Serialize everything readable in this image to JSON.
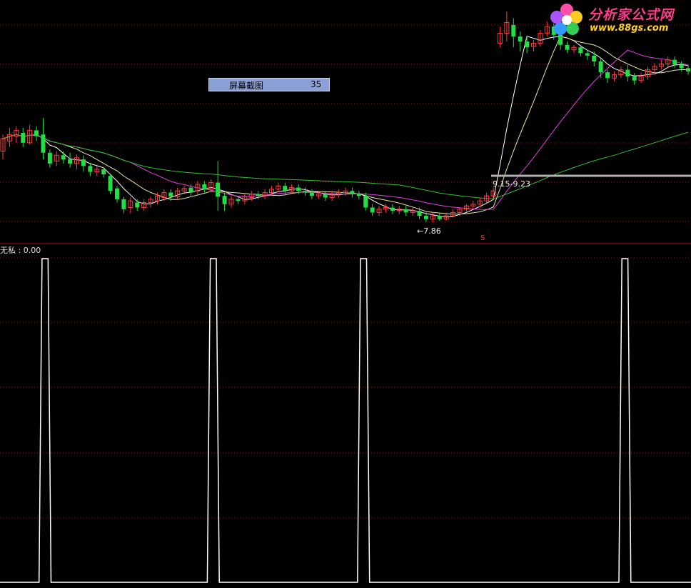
{
  "logo": {
    "title": "分析家公式网",
    "url": "www.88gs.com"
  },
  "screenshot_popup": {
    "label": "屏幕截图",
    "value": "35"
  },
  "indicator": {
    "label": "无私 : 0.00"
  },
  "annotations": {
    "low_marker": "←7.86",
    "range_label": "9.15-9.23",
    "signal_mark": "S"
  },
  "colors": {
    "up_candle": "#ff3b3b",
    "down_candle": "#22dd44",
    "ma_white": "#ffffff",
    "ma_yellow": "#e8e8a0",
    "ma_magenta": "#e040e0",
    "ma_green": "#30c030",
    "divider": "#c01010",
    "grid_dots": "#8a1a1a",
    "indicator_line": "#ffffff"
  },
  "chart_data": [
    {
      "type": "candlestick",
      "series": [
        {
          "name": "candles",
          "values": [
            [
              8.3,
              8.45,
              8.2,
              8.5
            ],
            [
              8.42,
              8.5,
              8.35,
              8.58
            ],
            [
              8.48,
              8.55,
              8.4,
              8.6
            ],
            [
              8.52,
              8.4,
              8.35,
              8.58
            ],
            [
              8.4,
              8.55,
              8.38,
              8.62
            ],
            [
              8.55,
              8.48,
              8.42,
              8.6
            ],
            [
              8.5,
              8.28,
              8.2,
              8.7
            ],
            [
              8.28,
              8.15,
              8.1,
              8.32
            ],
            [
              8.18,
              8.25,
              8.12,
              8.3
            ],
            [
              8.25,
              8.2,
              8.15,
              8.3
            ],
            [
              8.2,
              8.15,
              8.1,
              8.28
            ],
            [
              8.15,
              8.22,
              8.08,
              8.26
            ],
            [
              8.2,
              8.12,
              8.05,
              8.25
            ],
            [
              8.12,
              8.05,
              8.0,
              8.16
            ],
            [
              8.05,
              8.08,
              8.0,
              8.12
            ],
            [
              8.08,
              8.02,
              7.98,
              8.1
            ],
            [
              8.0,
              7.82,
              7.78,
              8.02
            ],
            [
              7.85,
              7.72,
              7.68,
              7.88
            ],
            [
              7.72,
              7.6,
              7.55,
              7.75
            ],
            [
              7.62,
              7.7,
              7.55,
              7.74
            ],
            [
              7.68,
              7.62,
              7.58,
              7.72
            ],
            [
              7.62,
              7.68,
              7.58,
              7.72
            ],
            [
              7.68,
              7.72,
              7.62,
              7.75
            ],
            [
              7.7,
              7.76,
              7.66,
              7.8
            ],
            [
              7.74,
              7.8,
              7.7,
              7.84
            ],
            [
              7.8,
              7.75,
              7.7,
              7.84
            ],
            [
              7.75,
              7.82,
              7.72,
              7.86
            ],
            [
              7.82,
              7.85,
              7.78,
              7.88
            ],
            [
              7.86,
              7.8,
              7.76,
              7.9
            ],
            [
              7.82,
              7.9,
              7.78,
              7.94
            ],
            [
              7.9,
              7.84,
              7.8,
              7.94
            ],
            [
              7.84,
              7.92,
              7.8,
              7.96
            ],
            [
              7.92,
              7.75,
              7.58,
              8.18
            ],
            [
              7.76,
              7.66,
              7.58,
              7.8
            ],
            [
              7.66,
              7.72,
              7.62,
              7.76
            ],
            [
              7.72,
              7.7,
              7.66,
              7.76
            ],
            [
              7.7,
              7.75,
              7.66,
              7.78
            ],
            [
              7.74,
              7.78,
              7.7,
              7.82
            ],
            [
              7.78,
              7.76,
              7.72,
              7.82
            ],
            [
              7.76,
              7.8,
              7.72,
              7.84
            ],
            [
              7.8,
              7.84,
              7.76,
              7.88
            ],
            [
              7.84,
              7.88,
              7.8,
              7.92
            ],
            [
              7.88,
              7.82,
              7.78,
              7.92
            ],
            [
              7.82,
              7.86,
              7.78,
              7.9
            ],
            [
              7.86,
              7.82,
              7.78,
              7.9
            ],
            [
              7.82,
              7.8,
              7.76,
              7.86
            ],
            [
              7.8,
              7.76,
              7.72,
              7.84
            ],
            [
              7.76,
              7.78,
              7.72,
              7.82
            ],
            [
              7.78,
              7.74,
              7.7,
              7.82
            ],
            [
              7.74,
              7.78,
              7.7,
              7.82
            ],
            [
              7.78,
              7.8,
              7.74,
              7.84
            ],
            [
              7.8,
              7.82,
              7.76,
              7.86
            ],
            [
              7.82,
              7.78,
              7.74,
              7.86
            ],
            [
              7.78,
              7.76,
              7.72,
              7.82
            ],
            [
              7.76,
              7.62,
              7.58,
              7.8
            ],
            [
              7.62,
              7.56,
              7.52,
              7.66
            ],
            [
              7.56,
              7.6,
              7.52,
              7.64
            ],
            [
              7.6,
              7.62,
              7.56,
              7.66
            ],
            [
              7.62,
              7.58,
              7.54,
              7.66
            ],
            [
              7.58,
              7.6,
              7.54,
              7.64
            ],
            [
              7.6,
              7.56,
              7.52,
              7.64
            ],
            [
              7.56,
              7.58,
              7.52,
              7.62
            ],
            [
              7.58,
              7.52,
              7.48,
              7.62
            ],
            [
              7.52,
              7.48,
              7.44,
              7.56
            ],
            [
              7.48,
              7.52,
              7.44,
              7.56
            ],
            [
              7.52,
              7.48,
              7.46,
              7.56
            ],
            [
              7.48,
              7.52,
              7.46,
              7.56
            ],
            [
              7.52,
              7.56,
              7.5,
              7.6
            ],
            [
              7.56,
              7.6,
              7.52,
              7.62
            ],
            [
              7.6,
              7.64,
              7.56,
              7.66
            ],
            [
              7.64,
              7.66,
              7.6,
              7.7
            ],
            [
              7.66,
              7.7,
              7.62,
              7.74
            ],
            [
              7.7,
              7.76,
              7.66,
              7.8
            ],
            [
              7.76,
              7.82,
              7.72,
              7.86
            ],
            [
              9.6,
              9.72,
              9.55,
              9.8
            ],
            [
              9.72,
              9.85,
              9.62,
              9.98
            ],
            [
              9.82,
              9.68,
              9.55,
              9.9
            ],
            [
              9.68,
              9.62,
              9.5,
              9.74
            ],
            [
              9.62,
              9.55,
              9.48,
              9.68
            ],
            [
              9.56,
              9.6,
              9.5,
              9.64
            ],
            [
              9.6,
              9.72,
              9.56,
              9.76
            ],
            [
              9.72,
              9.8,
              9.68,
              9.86
            ],
            [
              9.8,
              9.7,
              9.64,
              9.84
            ],
            [
              9.7,
              9.58,
              9.52,
              9.74
            ],
            [
              9.58,
              9.52,
              9.48,
              9.62
            ],
            [
              9.52,
              9.55,
              9.48,
              9.58
            ],
            [
              9.55,
              9.48,
              9.44,
              9.58
            ],
            [
              9.48,
              9.45,
              9.4,
              9.52
            ],
            [
              9.45,
              9.38,
              9.32,
              9.5
            ],
            [
              9.38,
              9.25,
              9.18,
              9.42
            ],
            [
              9.25,
              9.18,
              9.12,
              9.28
            ],
            [
              9.18,
              9.22,
              9.14,
              9.26
            ],
            [
              9.22,
              9.28,
              9.18,
              9.32
            ],
            [
              9.28,
              9.2,
              9.14,
              9.34
            ],
            [
              9.2,
              9.15,
              9.1,
              9.24
            ],
            [
              9.15,
              9.2,
              9.12,
              9.24
            ],
            [
              9.2,
              9.28,
              9.16,
              9.32
            ],
            [
              9.28,
              9.32,
              9.22,
              9.36
            ],
            [
              9.32,
              9.35,
              9.28,
              9.4
            ],
            [
              9.35,
              9.4,
              9.3,
              9.44
            ],
            [
              9.4,
              9.34,
              9.3,
              9.44
            ],
            [
              9.34,
              9.3,
              9.26,
              9.38
            ],
            [
              9.3,
              9.26,
              9.22,
              9.34
            ]
          ]
        }
      ],
      "ylim": [
        7.4,
        10.0
      ]
    },
    {
      "type": "line",
      "series": [
        {
          "name": "",
          "values": [
            0,
            0,
            0,
            0,
            0,
            0,
            0,
            0,
            0,
            0,
            0,
            0,
            0,
            0,
            1,
            1,
            1,
            0,
            0,
            0,
            0,
            0,
            0,
            0,
            0,
            0,
            0,
            0,
            0,
            0,
            0,
            0,
            0,
            0,
            0,
            0,
            0,
            0,
            0,
            0,
            0,
            0,
            0,
            0,
            0,
            0,
            0,
            0,
            0,
            0,
            0,
            0,
            0,
            0,
            0,
            0,
            0,
            0,
            0,
            0,
            0,
            0,
            0,
            0,
            0,
            0,
            0,
            0,
            0,
            0,
            1,
            1,
            1,
            0,
            0,
            0,
            0,
            0,
            0,
            0,
            0,
            0,
            0,
            0,
            0,
            0,
            0,
            0,
            0,
            0,
            0,
            0,
            0,
            0,
            0,
            0,
            0,
            0,
            0,
            0,
            0,
            0,
            0,
            0,
            0,
            0,
            0,
            0,
            0,
            0,
            0,
            0,
            0,
            0,
            0,
            0,
            0,
            0,
            0,
            0,
            1,
            1,
            1,
            0,
            0,
            0,
            0,
            0,
            0,
            0,
            0,
            0,
            0,
            0,
            0,
            0,
            0,
            0,
            0,
            0,
            0,
            0,
            0,
            0,
            0,
            0,
            0,
            0,
            0,
            0,
            0,
            0,
            0,
            0,
            0,
            0,
            0,
            0,
            0,
            0,
            0,
            0,
            0,
            0,
            0,
            0,
            0,
            0,
            0,
            0,
            0,
            0,
            0,
            0,
            0,
            0,
            0,
            0,
            0,
            0,
            0,
            0,
            0,
            0,
            0,
            0,
            0,
            0,
            0,
            0,
            0,
            0,
            0,
            0,
            0,
            0,
            0,
            0,
            0,
            0,
            0,
            0,
            0,
            0,
            0,
            0,
            0,
            1,
            1,
            1,
            0,
            0,
            0,
            0,
            0,
            0,
            0,
            0,
            0,
            0,
            0,
            0,
            0,
            0,
            0,
            0,
            0,
            0,
            0,
            0,
            0
          ]
        }
      ],
      "ylim": [
        0,
        1
      ]
    }
  ]
}
